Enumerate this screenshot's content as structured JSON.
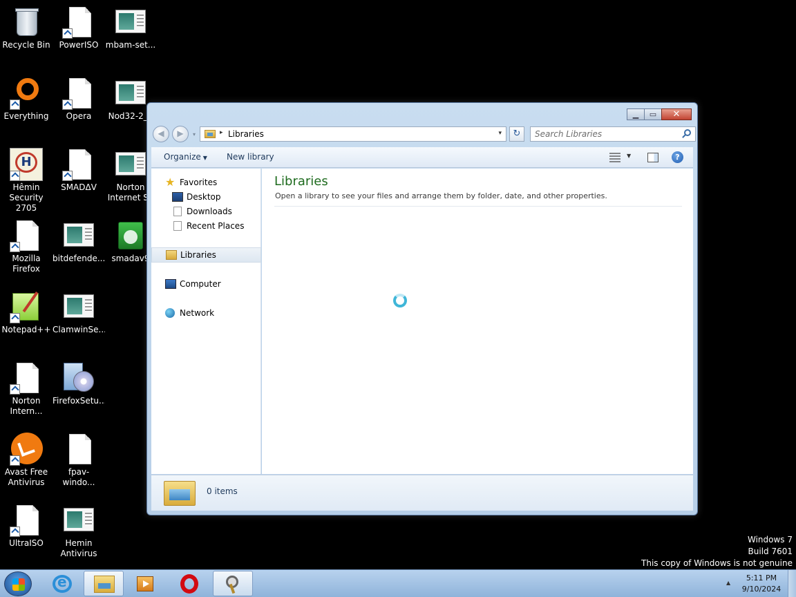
{
  "desktop": {
    "icons": [
      {
        "label": "Recycle Bin"
      },
      {
        "label": "PowerISO"
      },
      {
        "label": "mbam-set..."
      },
      {
        "label": "Everything"
      },
      {
        "label": "Opera"
      },
      {
        "label": "Nod32-2_E"
      },
      {
        "label": "Hêmin\nSecurity 2705"
      },
      {
        "label": "SMADΔV"
      },
      {
        "label": "Norton\nInternet Se"
      },
      {
        "label": "Mozilla\nFirefox"
      },
      {
        "label": "bitdefende..."
      },
      {
        "label": "smadav9"
      },
      {
        "label": "Notepad++"
      },
      {
        "label": "ClamwinSe..."
      },
      {
        "label": "Norton\nIntern..."
      },
      {
        "label": "FirefoxSetu..."
      },
      {
        "label": "Avast Free\nAntivirus"
      },
      {
        "label": "fpav-windo..."
      },
      {
        "label": "UltraISO"
      },
      {
        "label": "Hemin\nAntivirus"
      }
    ]
  },
  "explorer": {
    "caption_buttons": {
      "minimize": "▁",
      "maximize": "▭",
      "close": "✕"
    },
    "address": {
      "separator": "▸",
      "path": "Libraries",
      "dropdown": "▾"
    },
    "refresh_glyph": "↻",
    "search": {
      "placeholder": "Search Libraries"
    },
    "nav_back": "◀",
    "nav_forward": "▶",
    "recent_dropdown": "▾",
    "toolbar": {
      "organize": "Organize",
      "new_library": "New library",
      "dropdown_arrow": "▼",
      "help": "?"
    },
    "nav_pane": {
      "favorites": "Favorites",
      "favorites_items": [
        "Desktop",
        "Downloads",
        "Recent Places"
      ],
      "libraries": "Libraries",
      "computer": "Computer",
      "network": "Network",
      "star_glyph": "★"
    },
    "content": {
      "title": "Libraries",
      "subtitle": "Open a library to see your files and arrange them by folder, date, and other properties."
    },
    "details": {
      "count": "0 items"
    }
  },
  "watermark": {
    "line1": "Windows 7",
    "line2": "Build 7601",
    "line3": "This copy of Windows is not genuine"
  },
  "taskbar": {
    "time": "5:11 PM",
    "date": "9/10/2024",
    "tray_arrow": "▲"
  }
}
